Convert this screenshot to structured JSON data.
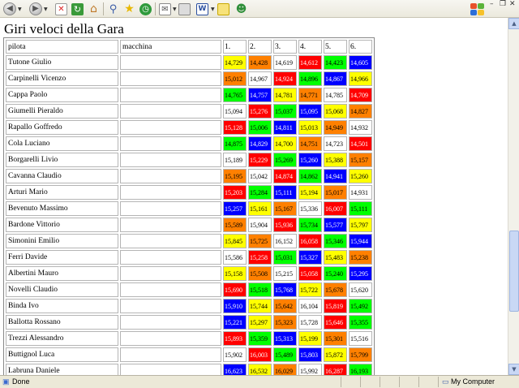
{
  "page_title": "Giri veloci della Gara",
  "table": {
    "headers": [
      "pilota",
      "macchina",
      "1.",
      "2.",
      "3.",
      "4.",
      "5.",
      "6."
    ],
    "rows": [
      {
        "pilota": "Tutone Giulio",
        "macchina": "",
        "times": [
          "14,729",
          "14,428",
          "14,619",
          "14,612",
          "14,423",
          "14,605"
        ],
        "colors": [
          "yellow",
          "orange",
          "white",
          "red",
          "green",
          "blue"
        ]
      },
      {
        "pilota": "Carpinelli Vicenzo",
        "macchina": "",
        "times": [
          "15,012",
          "14,967",
          "14,924",
          "14,896",
          "14,867",
          "14,966"
        ],
        "colors": [
          "orange",
          "white",
          "red",
          "green",
          "blue",
          "yellow"
        ]
      },
      {
        "pilota": "Cappa Paolo",
        "macchina": "",
        "times": [
          "14,765",
          "14,757",
          "14,781",
          "14,771",
          "14,785",
          "14,709"
        ],
        "colors": [
          "green",
          "blue",
          "yellow",
          "orange",
          "white",
          "red"
        ]
      },
      {
        "pilota": "Giumelli Pieraldo",
        "macchina": "",
        "times": [
          "15,094",
          "15,276",
          "15,037",
          "15,095",
          "15,068",
          "14,827"
        ],
        "colors": [
          "white",
          "red",
          "green",
          "blue",
          "yellow",
          "orange"
        ]
      },
      {
        "pilota": "Rapallo Goffredo",
        "macchina": "",
        "times": [
          "15,128",
          "15,006",
          "14,811",
          "15,013",
          "14,949",
          "14,932"
        ],
        "colors": [
          "red",
          "green",
          "blue",
          "yellow",
          "orange",
          "white"
        ]
      },
      {
        "pilota": "Cola Luciano",
        "macchina": "",
        "times": [
          "14,875",
          "14,829",
          "14,700",
          "14,751",
          "14,723",
          "14,501"
        ],
        "colors": [
          "green",
          "blue",
          "yellow",
          "orange",
          "white",
          "red"
        ]
      },
      {
        "pilota": "Borgarelli Livio",
        "macchina": "",
        "times": [
          "15,189",
          "15,229",
          "15,269",
          "15,260",
          "15,388",
          "15,157"
        ],
        "colors": [
          "white",
          "red",
          "green",
          "blue",
          "yellow",
          "orange"
        ]
      },
      {
        "pilota": "Cavanna Claudio",
        "macchina": "",
        "times": [
          "15,195",
          "15,042",
          "14,874",
          "14,862",
          "14,941",
          "15,260"
        ],
        "colors": [
          "orange",
          "white",
          "red",
          "green",
          "blue",
          "yellow"
        ]
      },
      {
        "pilota": "Arturi Mario",
        "macchina": "",
        "times": [
          "15,203",
          "15,284",
          "15,111",
          "15,194",
          "15,017",
          "14,931"
        ],
        "colors": [
          "red",
          "green",
          "blue",
          "yellow",
          "orange",
          "white"
        ]
      },
      {
        "pilota": "Bevenuto Massimo",
        "macchina": "",
        "times": [
          "15,257",
          "15,161",
          "15,167",
          "15,336",
          "16,007",
          "15,111"
        ],
        "colors": [
          "blue",
          "yellow",
          "orange",
          "white",
          "red",
          "green"
        ]
      },
      {
        "pilota": "Bardone Vittorio",
        "macchina": "",
        "times": [
          "15,589",
          "15,904",
          "15,936",
          "15,734",
          "15,577",
          "15,797"
        ],
        "colors": [
          "orange",
          "white",
          "red",
          "green",
          "blue",
          "yellow"
        ]
      },
      {
        "pilota": "Simonini Emilio",
        "macchina": "",
        "times": [
          "15,845",
          "15,725",
          "16,152",
          "16,058",
          "15,346",
          "15,944"
        ],
        "colors": [
          "yellow",
          "orange",
          "white",
          "red",
          "green",
          "blue"
        ]
      },
      {
        "pilota": "Ferri Davide",
        "macchina": "",
        "times": [
          "15,586",
          "15,258",
          "15,031",
          "15,327",
          "15,483",
          "15,238"
        ],
        "colors": [
          "white",
          "red",
          "green",
          "blue",
          "yellow",
          "orange"
        ]
      },
      {
        "pilota": "Albertini Mauro",
        "macchina": "",
        "times": [
          "15,158",
          "15,508",
          "15,215",
          "15,058",
          "15,240",
          "15,295"
        ],
        "colors": [
          "yellow",
          "orange",
          "white",
          "red",
          "green",
          "blue"
        ]
      },
      {
        "pilota": "Novelli Claudio",
        "macchina": "",
        "times": [
          "15,690",
          "15,518",
          "15,768",
          "15,722",
          "15,678",
          "15,620"
        ],
        "colors": [
          "red",
          "green",
          "blue",
          "yellow",
          "orange",
          "white"
        ]
      },
      {
        "pilota": "Binda Ivo",
        "macchina": "",
        "times": [
          "15,910",
          "15,744",
          "15,642",
          "16,104",
          "15,819",
          "15,492"
        ],
        "colors": [
          "blue",
          "yellow",
          "orange",
          "white",
          "red",
          "green"
        ]
      },
      {
        "pilota": "Ballotta Rossano",
        "macchina": "",
        "times": [
          "15,221",
          "15,297",
          "15,323",
          "15,728",
          "15,646",
          "15,355"
        ],
        "colors": [
          "blue",
          "yellow",
          "orange",
          "white",
          "red",
          "green"
        ]
      },
      {
        "pilota": "Trezzi Alessandro",
        "macchina": "",
        "times": [
          "15,893",
          "15,359",
          "15,313",
          "15,199",
          "15,301",
          "15,516"
        ],
        "colors": [
          "red",
          "green",
          "blue",
          "yellow",
          "orange",
          "white"
        ]
      },
      {
        "pilota": "Buttignol Luca",
        "macchina": "",
        "times": [
          "15,902",
          "16,003",
          "15,489",
          "15,803",
          "15,872",
          "15,799"
        ],
        "colors": [
          "white",
          "red",
          "green",
          "blue",
          "yellow",
          "orange"
        ]
      },
      {
        "pilota": "Labruna Daniele",
        "macchina": "",
        "times": [
          "16,623",
          "16,532",
          "16,029",
          "15,992",
          "16,287",
          "16,193"
        ],
        "colors": [
          "blue",
          "yellow",
          "orange",
          "white",
          "red",
          "green"
        ]
      }
    ]
  },
  "palette": {
    "yellow": "#ffff00",
    "orange": "#ff8000",
    "white": "#ffffff",
    "red": "#ff0000",
    "green": "#00ff00",
    "blue": "#0000ff"
  },
  "text_on": {
    "yellow": "#000000",
    "orange": "#000000",
    "white": "#000000",
    "red": "#ffffff",
    "green": "#000000",
    "blue": "#ffffff"
  },
  "toolbar": {
    "icons": [
      "back-icon",
      "forward-icon",
      "stop-icon",
      "refresh-icon",
      "home-icon",
      "search-icon",
      "favorites-icon",
      "history-icon",
      "mail-icon",
      "print-icon",
      "edit-word-icon",
      "discuss-icon",
      "messenger-icon"
    ]
  },
  "status_bar": {
    "text": "Done",
    "zone": "My Computer"
  }
}
